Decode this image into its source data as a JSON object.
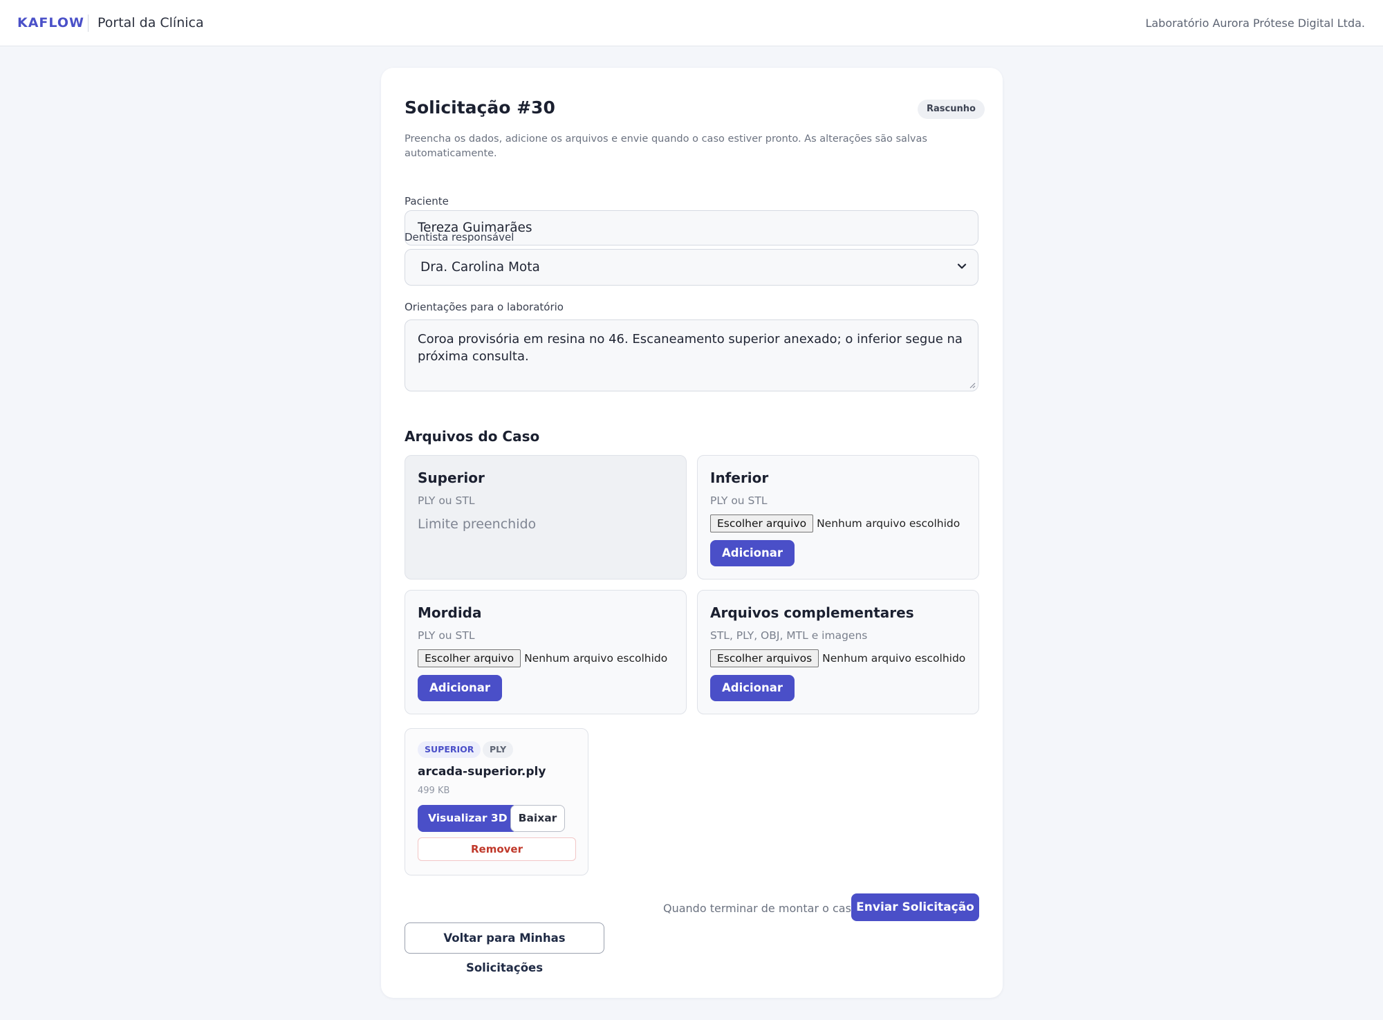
{
  "header": {
    "brand": "KAFLOW",
    "portal": "Portal da Clínica",
    "lab_name": "Laboratório Aurora Prótese Digital Ltda."
  },
  "request": {
    "title": "Solicitação #30",
    "status": "Rascunho",
    "intro": "Preencha os dados, adicione os arquivos e envie quando o caso estiver pronto. As alterações são salvas automaticamente."
  },
  "form": {
    "patient_label": "Paciente",
    "patient_value": "Tereza Guimarães",
    "dentist_label": "Dentista responsável",
    "dentist_value": "Dra. Carolina Mota",
    "notes_label": "Orientações para o laboratório",
    "notes_value": "Coroa provisória em resina no 46. Escaneamento superior anexado; o inferior segue na próxima consulta."
  },
  "files": {
    "section_title": "Arquivos do Caso",
    "slots": [
      {
        "name": "Superior",
        "formats": "PLY ou STL",
        "limit_text": "Limite preenchido"
      },
      {
        "name": "Inferior",
        "formats": "PLY ou STL",
        "choose_label": "Escolher arquivo",
        "no_file": "Nenhum arquivo escolhido",
        "add_label": "Adicionar"
      },
      {
        "name": "Mordida",
        "formats": "PLY ou STL",
        "choose_label": "Escolher arquivo",
        "no_file": "Nenhum arquivo escolhido",
        "add_label": "Adicionar"
      },
      {
        "name": "Arquivos complementares",
        "formats": "STL, PLY, OBJ, MTL e imagens",
        "choose_label": "Escolher arquivos",
        "no_file": "Nenhum arquivo escolhido",
        "add_label": "Adicionar"
      }
    ],
    "uploaded": [
      {
        "slot_tag": "SUPERIOR",
        "type_tag": "PLY",
        "filename": "arcada-superior.ply",
        "size": "499 KB",
        "view_label": "Visualizar 3D",
        "download_label": "Baixar",
        "remove_label": "Remover"
      }
    ]
  },
  "footer": {
    "submit_hint": "Quando terminar de montar o caso:",
    "submit_label": "Enviar Solicitação",
    "back_label": "Voltar para Minhas Solicitações"
  },
  "colors": {
    "accent": "#4a4fc8",
    "danger": "#c0392b",
    "background": "#f4f6fa"
  },
  "icons": {
    "select": "chevron-down-icon",
    "textarea": "resize-grip-icon"
  }
}
